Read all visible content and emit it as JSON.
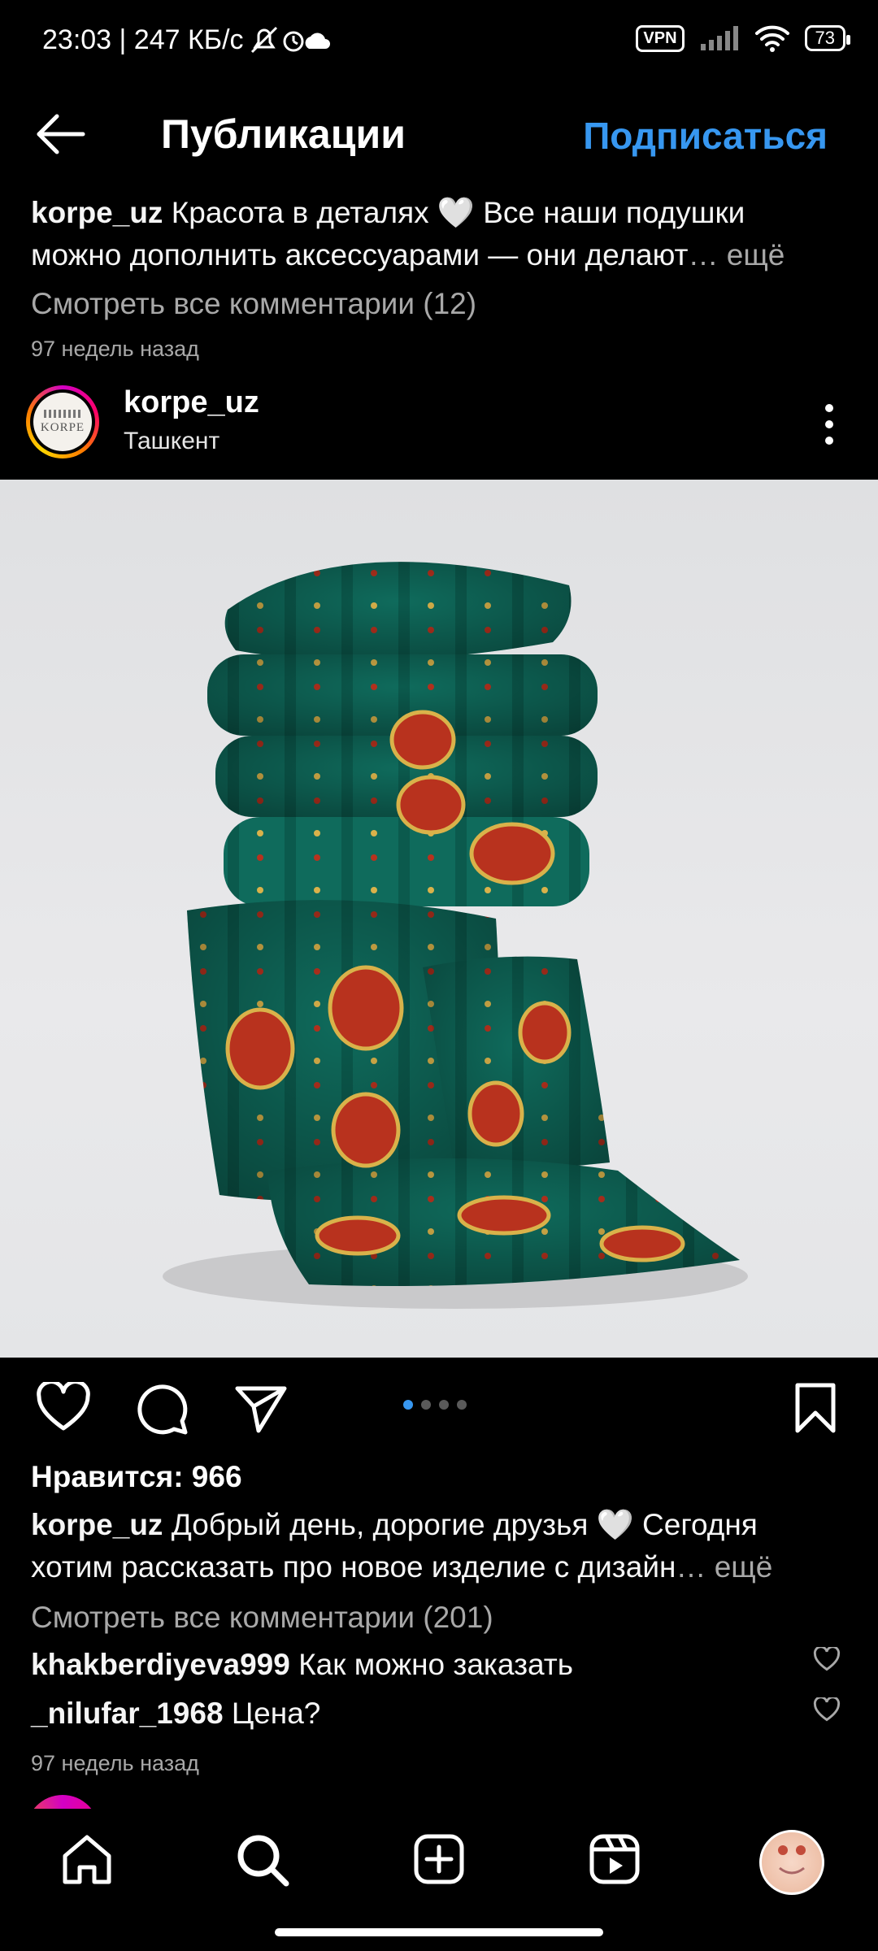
{
  "status_bar": {
    "time_speed": "23:03 | 247 КБ/с",
    "vpn": "VPN",
    "battery": "73"
  },
  "header": {
    "title": "Публикации",
    "follow": "Подписаться"
  },
  "prev_post": {
    "username": "korpe_uz",
    "caption_line1": "Красота в деталях 🤍 Все наши подушки",
    "caption_line2": "можно дополнить аксессуарами —  они делают",
    "more": "… ещё",
    "view_comments": "Смотреть все комментарии (12)",
    "time": "97 недель назад"
  },
  "post": {
    "avatar_text": "KORPE",
    "username": "korpe_uz",
    "location": "Ташкент",
    "likes": "Нравится: 966",
    "caption_line1": "Добрый день, дорогие друзья 🤍 Сегодня",
    "caption_line2": "хотим рассказать про новое изделие с дизайн",
    "more": "… ещё",
    "view_comments": "Смотреть все комментарии (201)",
    "comments": [
      {
        "user": "khakberdiyeva999",
        "text": "Как можно заказать"
      },
      {
        "user": "_nilufar_1968",
        "text": "Цена?"
      }
    ],
    "time": "97 недель назад"
  },
  "colors": {
    "accent": "#3797f0",
    "pillow_green": "#0f6b5c",
    "ornament_red": "#b8321e",
    "ornament_gold": "#d9b24a"
  },
  "icons": [
    "back-arrow-icon",
    "more-icon",
    "heart-icon",
    "comment-icon",
    "share-icon",
    "bookmark-icon",
    "home-icon",
    "search-icon",
    "create-icon",
    "reels-icon",
    "profile-avatar"
  ]
}
